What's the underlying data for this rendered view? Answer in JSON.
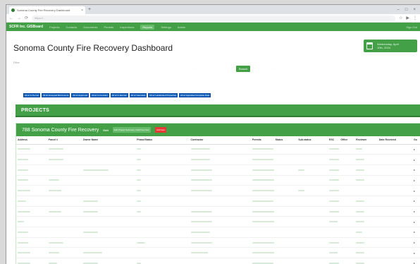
{
  "browser": {
    "tab_title": "Sonoma County Fire Recovery Dashboard",
    "new_tab_symbol": "+",
    "url": "https://..."
  },
  "topnav": {
    "brand": "SCFR Inc. GISBoard",
    "items": [
      "Projects",
      "Contacts",
      "Documents",
      "Permits",
      "Inspections",
      "Reports",
      "Settings",
      "Admin"
    ],
    "right": "Sign Out"
  },
  "page": {
    "title": "Sonoma County Fire Recovery Dashboard"
  },
  "datebox": {
    "line1": "Wednesday, April",
    "line2": "10th, 2024"
  },
  "filter": {
    "label": "Filter",
    "search_label": "Search"
  },
  "chips": [
    "All w/ in Permit",
    "All w/ Accepted Bid Amount",
    "All w/ Approved",
    "All w/ in Contract",
    "All w/ in Escrow",
    "All w/ Canceled",
    "All w/ Landlocked Properties",
    "All w/ Appraisal Complete Date"
  ],
  "projects_bar": "PROJECTS",
  "panel": {
    "title": "788 Sonoma County Fire Recovery",
    "edit": "Edit",
    "btn_primary": "Edit Project Summary / Add New Item",
    "btn_danger": "Add Item"
  },
  "table": {
    "columns": [
      "Address",
      "Parcel #",
      "Owner Name",
      "Phase/Status",
      "Contractor",
      "Permits",
      "Status",
      "Sub-status",
      "ESC",
      "Office",
      "Reviewer",
      "Date Received",
      "Go"
    ],
    "col_widths": [
      8,
      9,
      14,
      14,
      16,
      6,
      6,
      8,
      3,
      4,
      6,
      9,
      2
    ],
    "rows": [
      [
        6,
        7,
        0,
        2,
        9,
        10,
        0,
        0,
        6,
        0,
        3,
        0,
        0
      ],
      [
        5,
        7,
        0,
        2,
        9,
        10,
        0,
        0,
        6,
        0,
        4,
        0,
        0
      ],
      [
        5,
        0,
        12,
        2,
        10,
        11,
        0,
        3,
        7,
        0,
        4,
        0,
        0
      ],
      [
        5,
        5,
        0,
        2,
        10,
        11,
        0,
        0,
        6,
        0,
        4,
        0,
        8
      ],
      [
        6,
        6,
        0,
        2,
        10,
        11,
        0,
        3,
        6,
        0,
        0,
        0,
        0
      ],
      [
        4,
        0,
        7,
        2,
        0,
        10,
        0,
        0,
        6,
        0,
        4,
        0,
        0
      ],
      [
        6,
        6,
        7,
        2,
        10,
        11,
        0,
        0,
        6,
        0,
        4,
        0,
        0
      ],
      [
        3,
        0,
        0,
        0,
        10,
        11,
        0,
        0,
        4,
        0,
        4,
        0,
        0
      ],
      [
        5,
        0,
        7,
        0,
        9,
        0,
        0,
        0,
        0,
        0,
        3,
        0,
        0
      ],
      [
        5,
        7,
        0,
        4,
        10,
        11,
        0,
        0,
        6,
        0,
        4,
        0,
        8
      ],
      [
        6,
        5,
        9,
        0,
        8,
        11,
        0,
        0,
        4,
        0,
        4,
        0,
        0
      ],
      [
        6,
        4,
        7,
        2,
        0,
        10,
        0,
        0,
        6,
        0,
        4,
        0,
        0
      ]
    ]
  },
  "icons": {
    "back": "arrow-left-icon",
    "forward": "arrow-right-icon",
    "reload": "reload-icon",
    "calendar": "calendar-icon",
    "row_arrow": "chevron-right-icon"
  },
  "colors": {
    "primary": "#43a047",
    "primary_dark": "#2e7d32",
    "chip": "#1565c0",
    "danger": "#e53935"
  }
}
